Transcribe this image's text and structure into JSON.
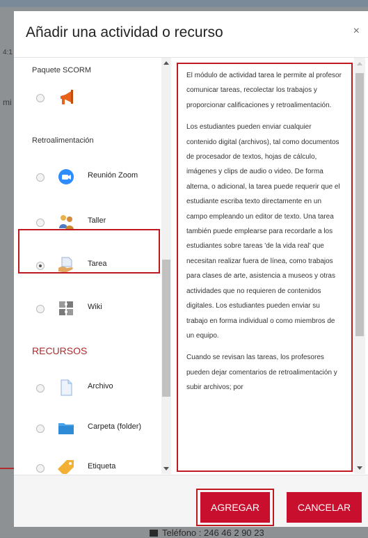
{
  "background": {
    "time_fragment": "4:1",
    "text_fragment": "mi",
    "footer_text": "Teléfono : 246 46 2 90 23"
  },
  "modal": {
    "title": "Añadir una actividad o recurso",
    "close_glyph": "×"
  },
  "activity_list": {
    "header_scorm": "Paquete SCORM",
    "section_feedback": "Retroalimentación",
    "section_resources": "RECURSOS",
    "items": [
      {
        "label": "",
        "icon": "megaphone-icon",
        "selected": false
      },
      {
        "label": "Reunión Zoom",
        "icon": "zoom-camera-icon",
        "selected": false
      },
      {
        "label": "Taller",
        "icon": "workshop-people-icon",
        "selected": false
      },
      {
        "label": "Tarea",
        "icon": "assignment-hand-icon",
        "selected": true
      },
      {
        "label": "Wiki",
        "icon": "wiki-puzzle-icon",
        "selected": false
      },
      {
        "label": "Archivo",
        "icon": "file-icon",
        "selected": false
      },
      {
        "label": "Carpeta (folder)",
        "icon": "folder-icon",
        "selected": false
      },
      {
        "label": "Etiqueta",
        "icon": "label-tag-icon",
        "selected": false
      }
    ]
  },
  "description": {
    "paragraphs": [
      "El módulo de actividad tarea le permite al profesor comunicar tareas, recolectar los trabajos y proporcionar calificaciones y retroalimentación.",
      "Los estudiantes pueden enviar cualquier contenido digital (archivos), tal como documentos de procesador de textos, hojas de cálculo, imágenes y clips de audio o video. De forma alterna, o adicional, la tarea puede requerir que el estudiante escriba texto directamente en un campo empleando un editor de texto. Una tarea también puede emplearse para recordarle a los estudiantes sobre tareas 'de la vida real' que necesitan realizar fuera de línea, como trabajos para clases de arte, asistencia a museos y otras actividades que no requieren de contenidos digitales. Los estudiantes pueden enviar su trabajo en forma individual o como miembros de un equipo.",
      "Cuando se revisan las tareas, los profesores pueden dejar comentarios de retroalimentación y subir archivos; por"
    ]
  },
  "footer": {
    "add_label": "AGREGAR",
    "cancel_label": "CANCELAR"
  },
  "colors": {
    "accent": "#c8102e",
    "highlight_border": "#c0181f",
    "section_title": "#b02a2a"
  }
}
